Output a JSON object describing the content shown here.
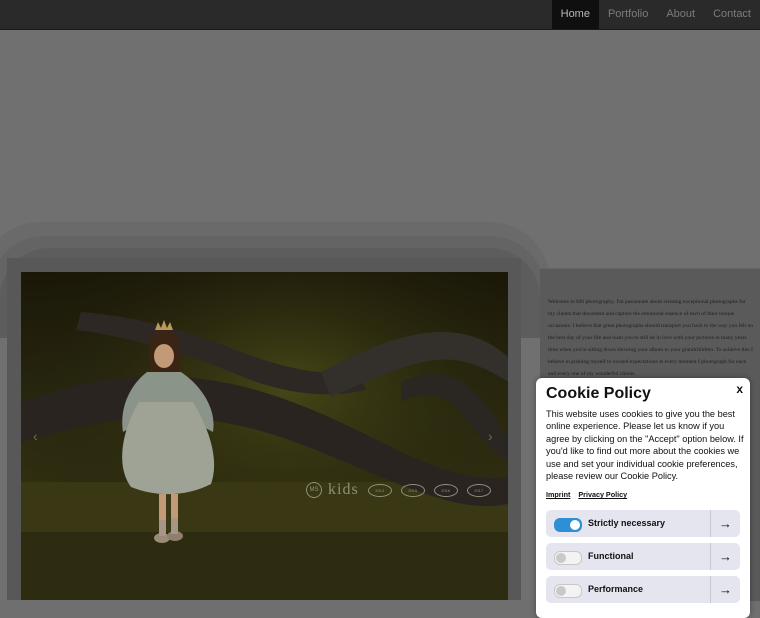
{
  "nav": {
    "items": [
      {
        "label": "Home",
        "active": true
      },
      {
        "label": "Portfolio",
        "active": false
      },
      {
        "label": "About",
        "active": false
      },
      {
        "label": "Contact",
        "active": false
      }
    ]
  },
  "intro": {
    "text": "Welcome to MS photography. I'm passionate about creating exceptional photographs for my clients that document and capture the emotional essence of each of their unique occasions. I believe that great photographs should transport you back to the way you felt on the best day of your life and want you to still be in love with your pictures in many years time when you're sitting down showing your album to your grandchildren. To achieve this I believe in pushing myself to exceed expectations at every moment I photograph for each and every one of my wonderful clients."
  },
  "slider": {
    "prev_icon": "chevron-left-icon",
    "next_icon": "chevron-right-icon",
    "watermark": {
      "logo": "MS",
      "text": "kids",
      "badges": [
        "2014",
        "2015",
        "2016",
        "2017"
      ]
    }
  },
  "cookie": {
    "title": "Cookie Policy",
    "close": "x",
    "body": "This website uses cookies to give you the best online experience. Please let us know if you agree by clicking on the \"Accept\" option below. If you'd like to find out more about the cookies we use and set your individual cookie preferences, please review our Cookie Policy.",
    "links": {
      "imprint": "Imprint",
      "privacy": "Privacy Policy"
    },
    "options": [
      {
        "label": "Strictly necessary",
        "enabled": true
      },
      {
        "label": "Functional",
        "enabled": false
      },
      {
        "label": "Performance",
        "enabled": false
      }
    ],
    "arrow": "→"
  },
  "colors": {
    "toggle_on": "#2f8fd4",
    "option_bg": "#e4e5ee",
    "nav_active_bg": "#0f0f0f"
  }
}
